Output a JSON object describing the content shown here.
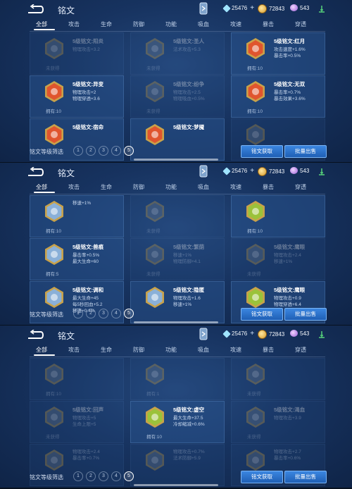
{
  "app": {
    "title": "铭文"
  },
  "resources": {
    "diamond": "25476",
    "coin": "72843",
    "crystal": "543"
  },
  "tabs": [
    "全部",
    "攻击",
    "生命",
    "防御",
    "功能",
    "吸血",
    "攻速",
    "暴击",
    "穿透"
  ],
  "level_filter": {
    "label": "铭文等级筛选",
    "levels": [
      "1",
      "2",
      "3",
      "4",
      "5"
    ],
    "selected": "5"
  },
  "buttons": {
    "acquire": "铭文获取",
    "sell": "批量出售"
  },
  "colors": {
    "panel_bg": "#173360",
    "button": "#2c74d0",
    "red_rune": "#e0552e",
    "blue_rune": "#8ab0d8",
    "green_rune": "#9bc23a"
  },
  "panels": [
    {
      "cards": [
        {
          "col": 0,
          "row": 0,
          "color": "#6d7f93",
          "dim": true,
          "name": "5级铭文:阳炎",
          "stats": [
            "物理攻击+3.2"
          ],
          "owned": "未获得"
        },
        {
          "col": 1,
          "row": 0,
          "color": "#6d7f93",
          "dim": true,
          "name": "5级铭文:圣人",
          "stats": [
            "法术攻击+5.3"
          ],
          "owned": "未获得"
        },
        {
          "col": 2,
          "row": 0,
          "color": "#e0552e",
          "dim": false,
          "name": "5级铭文:红月",
          "stats": [
            "攻击速度+1.6%",
            "暴击率+0.5%"
          ],
          "owned": "拥有:10"
        },
        {
          "col": 0,
          "row": 1,
          "color": "#e0552e",
          "dim": false,
          "name": "5级铭文:异变",
          "stats": [
            "物理攻击+2",
            "物理穿透+3.6"
          ],
          "owned": "拥有:10"
        },
        {
          "col": 1,
          "row": 1,
          "color": "#6d7f93",
          "dim": true,
          "name": "5级铭文:纷争",
          "stats": [
            "物理攻击+2.5",
            "物理吸血+0.5%"
          ],
          "owned": "未获得"
        },
        {
          "col": 2,
          "row": 1,
          "color": "#e0552e",
          "dim": false,
          "name": "5级铭文:无双",
          "stats": [
            "暴击率+0.7%",
            "暴击效果+3.6%"
          ],
          "owned": "拥有:10"
        },
        {
          "col": 0,
          "row": 2,
          "color": "#e0552e",
          "dim": false,
          "name": "5级铭文:宿命",
          "stats": [],
          "owned": ""
        },
        {
          "col": 1,
          "row": 2,
          "color": "#e0552e",
          "dim": false,
          "name": "5级铭文:梦魇",
          "stats": [],
          "owned": ""
        },
        {
          "col": 2,
          "row": 2,
          "color": "#6d7f93",
          "dim": true,
          "name": "",
          "stats": [],
          "owned": ""
        }
      ]
    },
    {
      "cards": [
        {
          "col": 0,
          "row": 0,
          "color": "#8ab0d8",
          "dim": false,
          "name": "",
          "stats": [
            "移速+1%"
          ],
          "owned": "拥有:10"
        },
        {
          "col": 1,
          "row": 0,
          "color": "#6d7f93",
          "dim": true,
          "name": "",
          "stats": [],
          "owned": "未获得"
        },
        {
          "col": 2,
          "row": 0,
          "color": "#9bc23a",
          "dim": false,
          "name": "",
          "stats": [],
          "owned": "拥有:10"
        },
        {
          "col": 0,
          "row": 1,
          "color": "#8ab0d8",
          "dim": false,
          "name": "5级铭文:兽痕",
          "stats": [
            "暴击率+0.5%",
            "最大生命+60"
          ],
          "owned": "拥有:5"
        },
        {
          "col": 1,
          "row": 1,
          "color": "#6d7f93",
          "dim": true,
          "name": "5级铭文:繁荫",
          "stats": [
            "移速+1%",
            "物理防御+4.1"
          ],
          "owned": "未获得"
        },
        {
          "col": 2,
          "row": 1,
          "color": "#6d7f93",
          "dim": true,
          "name": "5级铭文:鹰眼",
          "stats": [
            "物理攻击+2.4",
            "移速+1%"
          ],
          "owned": "未获得"
        },
        {
          "col": 0,
          "row": 2,
          "color": "#8ab0d8",
          "dim": false,
          "name": "5级铭文:调和",
          "stats": [
            "最大生命+45",
            "每5秒回血+5.2",
            "移速+0.4%"
          ],
          "owned": ""
        },
        {
          "col": 1,
          "row": 2,
          "color": "#8ab0d8",
          "dim": false,
          "name": "5级铭文:隐匿",
          "stats": [
            "物理攻击+1.6",
            "移速+1%"
          ],
          "owned": ""
        },
        {
          "col": 2,
          "row": 2,
          "color": "#9bc23a",
          "dim": false,
          "name": "5级铭文:鹰眼",
          "stats": [
            "物理攻击+0.9",
            "物理穿透+6.4"
          ],
          "owned": ""
        }
      ]
    },
    {
      "cards": [
        {
          "col": 0,
          "row": 0,
          "color": "#6d7f93",
          "dim": true,
          "name": "",
          "stats": [],
          "owned": "拥有:10"
        },
        {
          "col": 1,
          "row": 0,
          "color": "#6d7f93",
          "dim": true,
          "name": "",
          "stats": [],
          "owned": "拥有:1"
        },
        {
          "col": 2,
          "row": 0,
          "color": "#6d7f93",
          "dim": true,
          "name": "",
          "stats": [],
          "owned": "未获得"
        },
        {
          "col": 0,
          "row": 1,
          "color": "#6d7f93",
          "dim": true,
          "name": "5级铭文:回声",
          "stats": [
            "物理攻击+5",
            "生命上限+5"
          ],
          "owned": "未获得"
        },
        {
          "col": 1,
          "row": 1,
          "color": "#9bc23a",
          "dim": false,
          "name": "5级铭文:虚空",
          "stats": [
            "最大生命+37.5",
            "冷却缩减+0.6%"
          ],
          "owned": "拥有:10"
        },
        {
          "col": 2,
          "row": 1,
          "color": "#6d7f93",
          "dim": true,
          "name": "5级铭文:渴血",
          "stats": [
            "物理攻击+3.9"
          ],
          "owned": "未获得"
        },
        {
          "col": 0,
          "row": 2,
          "color": "#6d7f93",
          "dim": true,
          "name": "",
          "stats": [
            "物理攻击+2.4",
            "暴击率+0.7%"
          ],
          "owned": ""
        },
        {
          "col": 1,
          "row": 2,
          "color": "#6d7f93",
          "dim": true,
          "name": "",
          "stats": [
            "物理攻击+0.7%",
            "法术防御+5.9"
          ],
          "owned": ""
        },
        {
          "col": 2,
          "row": 2,
          "color": "#6d7f93",
          "dim": true,
          "name": "",
          "stats": [
            "物理攻击+2.7",
            "暴击率+0.6%"
          ],
          "owned": ""
        }
      ]
    }
  ]
}
